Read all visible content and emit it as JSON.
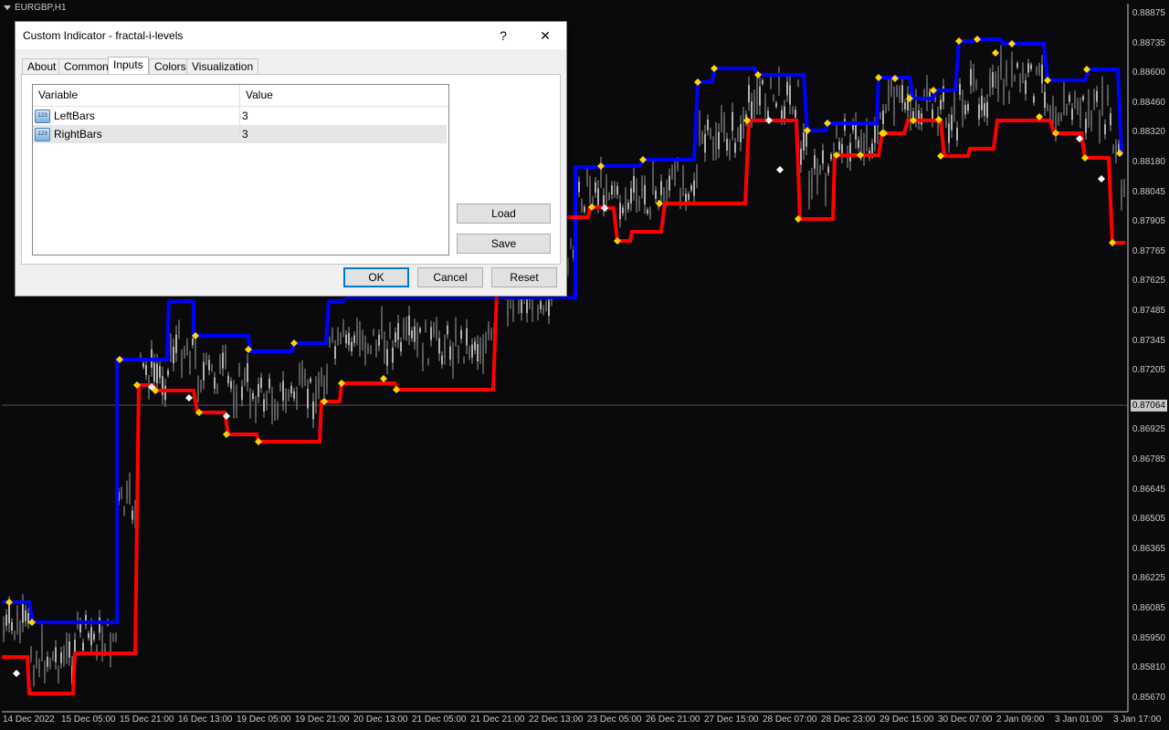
{
  "chart": {
    "symbol": "EURGBP,H1",
    "current_price": "0.87064",
    "price_axis": [
      "0.88875",
      "0.88735",
      "0.88600",
      "0.88460",
      "0.88320",
      "0.88180",
      "0.88045",
      "0.87905",
      "0.87765",
      "0.87625",
      "0.87485",
      "0.87345",
      "0.87205",
      "0.87064",
      "0.86925",
      "0.86785",
      "0.86645",
      "0.86505",
      "0.86365",
      "0.86225",
      "0.86085",
      "0.85950",
      "0.85810",
      "0.85670"
    ],
    "time_axis": [
      "14 Dec 2022",
      "15 Dec 05:00",
      "15 Dec 21:00",
      "16 Dec 13:00",
      "19 Dec 05:00",
      "19 Dec 21:00",
      "20 Dec 13:00",
      "21 Dec 05:00",
      "21 Dec 21:00",
      "22 Dec 13:00",
      "23 Dec 05:00",
      "26 Dec 21:00",
      "27 Dec 15:00",
      "28 Dec 07:00",
      "28 Dec 23:00",
      "29 Dec 15:00",
      "30 Dec 07:00",
      "2 Jan 09:00",
      "3 Jan 01:00",
      "3 Jan 17:00"
    ],
    "colors": {
      "upper_level": "#0000ff",
      "lower_level": "#ff0000",
      "fractal": "#ffd700",
      "marker": "#ffffff",
      "candle": "#9a9a9a",
      "background": "#0a0a0d"
    }
  },
  "dialog": {
    "title": "Custom Indicator - fractal-i-levels",
    "help_icon": "?",
    "close_icon": "✕",
    "tabs": [
      "About",
      "Common",
      "Inputs",
      "Colors",
      "Visualization"
    ],
    "active_tab": "Inputs",
    "columns": [
      "Variable",
      "Value"
    ],
    "rows": [
      {
        "variable": "LeftBars",
        "value": "3",
        "icon": "123-icon"
      },
      {
        "variable": "RightBars",
        "value": "3",
        "icon": "123-icon"
      }
    ],
    "side_buttons": {
      "load": "Load",
      "save": "Save"
    },
    "footer_buttons": {
      "ok": "OK",
      "cancel": "Cancel",
      "reset": "Reset"
    }
  }
}
